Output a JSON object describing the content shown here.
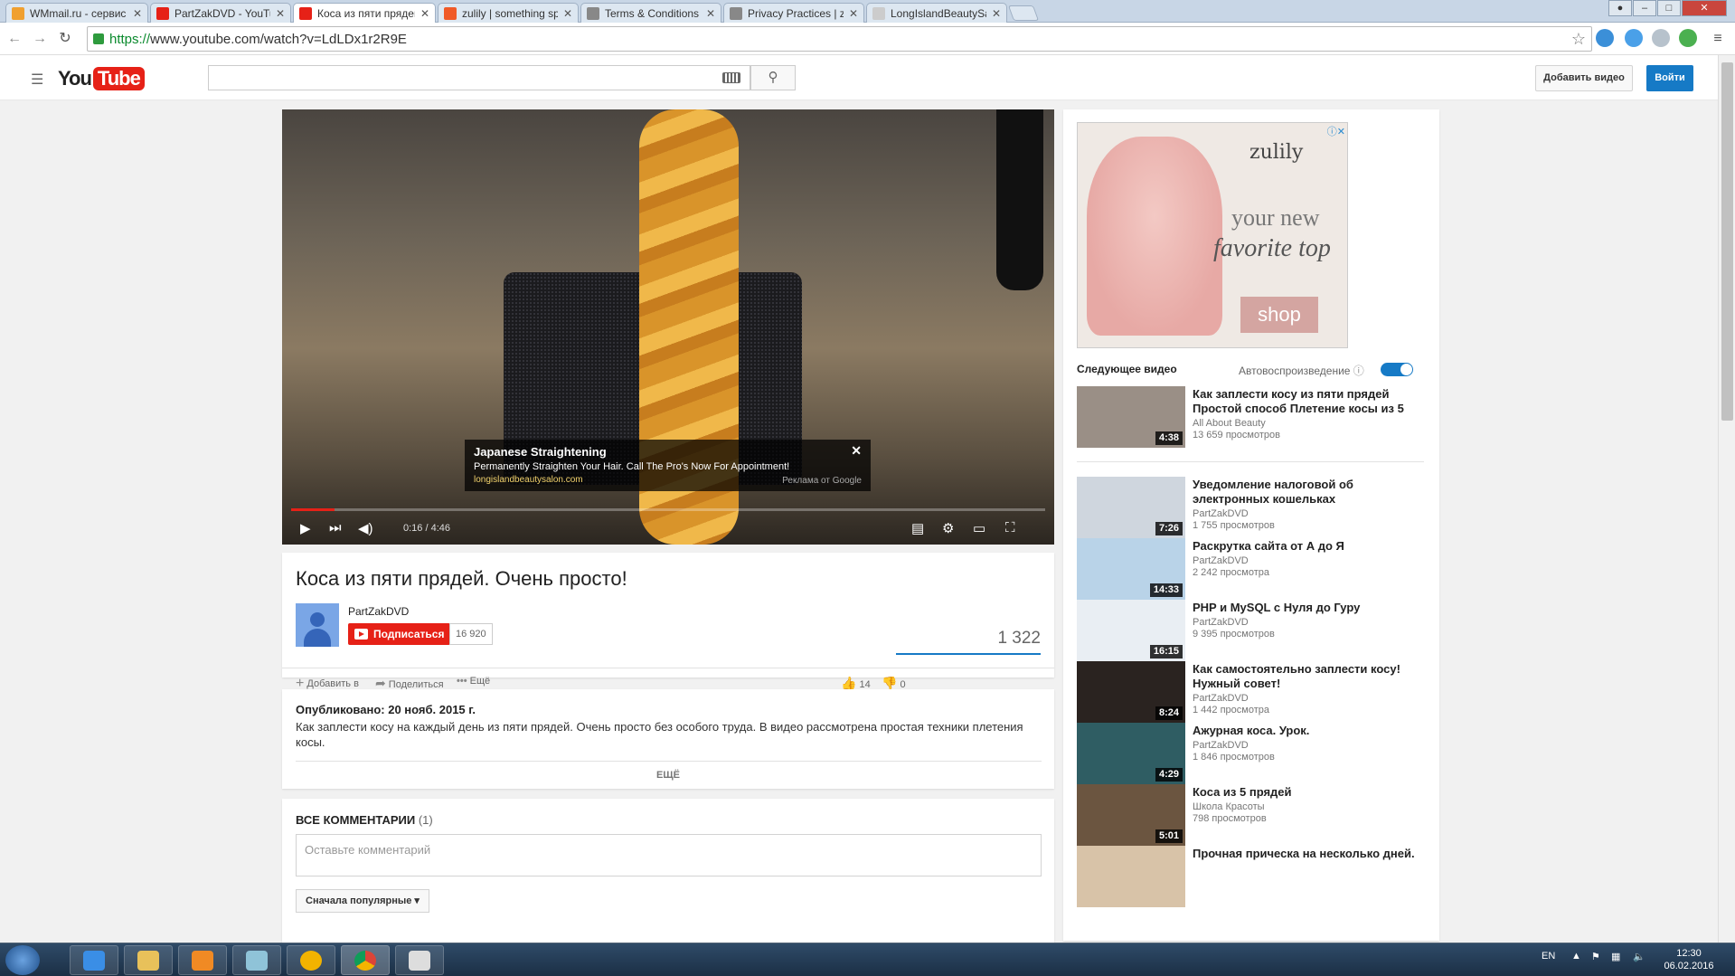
{
  "browser": {
    "tabs": [
      {
        "title": "WMmail.ru - сервис почт",
        "favicon_color": "#f0a030"
      },
      {
        "title": "PartZakDVD - YouTube",
        "favicon_color": "#e62117"
      },
      {
        "title": "Коса из пяти прядей. Оче",
        "favicon_color": "#e62117"
      },
      {
        "title": "zulily | something special",
        "favicon_color": "#f05a28"
      },
      {
        "title": "Terms & Conditions | zulily",
        "favicon_color": "#888888"
      },
      {
        "title": "Privacy Practices | zulily",
        "favicon_color": "#888888"
      },
      {
        "title": "LongIslandBeautySalon",
        "favicon_color": "#cccccc"
      }
    ],
    "close_glyph": "✕",
    "url_scheme": "https://",
    "url_rest": "www.youtube.com/watch?v=LdLDx1r2R9E"
  },
  "masthead": {
    "logo_you": "You",
    "logo_tube": "Tube",
    "search_placeholder": "",
    "upload_label": "Добавить видео",
    "signin_label": "Войти"
  },
  "player": {
    "ad_title": "Japanese Straightening",
    "ad_text": "Permanently Straighten Your Hair. Call The Pro's Now For Appointment!",
    "ad_url": "longislandbeautysalon.com",
    "ad_label": "Реклама от Google",
    "ad_close": "✕",
    "time": "0:16 / 4:46",
    "progress_fraction": 0.057
  },
  "video": {
    "title": "Коса из пяти прядей. Очень просто!",
    "channel": "PartZakDVD",
    "subscribe_label": "Подписаться",
    "subscriber_count": "16 920",
    "views": "1 322",
    "add_to": "Добавить в",
    "share": "Поделиться",
    "more": "Ещё",
    "likes": "14",
    "dislikes": "0"
  },
  "description": {
    "published": "Опубликовано: 20 нояб. 2015 г.",
    "text": "Как заплести косу на каждый день из пяти прядей. Очень просто без особого труда. В видео рассмотрена простая техники плетения косы.",
    "more_label": "ЕЩЁ"
  },
  "comments": {
    "header": "ВСЕ КОММЕНТАРИИ",
    "count": "(1)",
    "placeholder": "Оставьте комментарий",
    "sort_label": "Сначала популярные"
  },
  "sidebar": {
    "ad": {
      "brand": "zulily",
      "line1": "your new",
      "line2": "favorite top",
      "cta": "shop"
    },
    "up_next": "Следующее видео",
    "autoplay": "Автовоспроизведение",
    "videos": [
      {
        "title": "Как заплести косу из пяти прядей Простой способ Плетение косы из 5",
        "channel": "All About Beauty",
        "views": "13 659 просмотров",
        "duration": "4:38",
        "color": "#9a8f86"
      },
      {
        "title": "Уведомление налоговой об электронных кошельках",
        "channel": "PartZakDVD",
        "views": "1 755 просмотров",
        "duration": "7:26",
        "color": "#cfd6de"
      },
      {
        "title": "Раскрутка сайта от А до Я",
        "channel": "PartZakDVD",
        "views": "2 242 просмотра",
        "duration": "14:33",
        "color": "#b9d3e8"
      },
      {
        "title": "PHP и MySQL с Нуля до Гуру",
        "channel": "PartZakDVD",
        "views": "9 395 просмотров",
        "duration": "16:15",
        "color": "#e9eef3"
      },
      {
        "title": "Как самостоятельно заплести косу! Нужный совет!",
        "channel": "PartZakDVD",
        "views": "1 442 просмотра",
        "duration": "8:24",
        "color": "#2a2320"
      },
      {
        "title": "Ажурная коса. Урок.",
        "channel": "PartZakDVD",
        "views": "1 846 просмотров",
        "duration": "4:29",
        "color": "#2f5d63"
      },
      {
        "title": "Коса из 5 прядей",
        "channel": "Школа Красоты",
        "views": "798 просмотров",
        "duration": "5:01",
        "color": "#6b5540"
      },
      {
        "title": "Прочная прическа на несколько дней.",
        "channel": "",
        "views": "",
        "duration": "",
        "color": "#d8c3a8"
      }
    ]
  },
  "taskbar": {
    "lang": "EN",
    "time": "12:30",
    "date": "06.02.2016"
  }
}
